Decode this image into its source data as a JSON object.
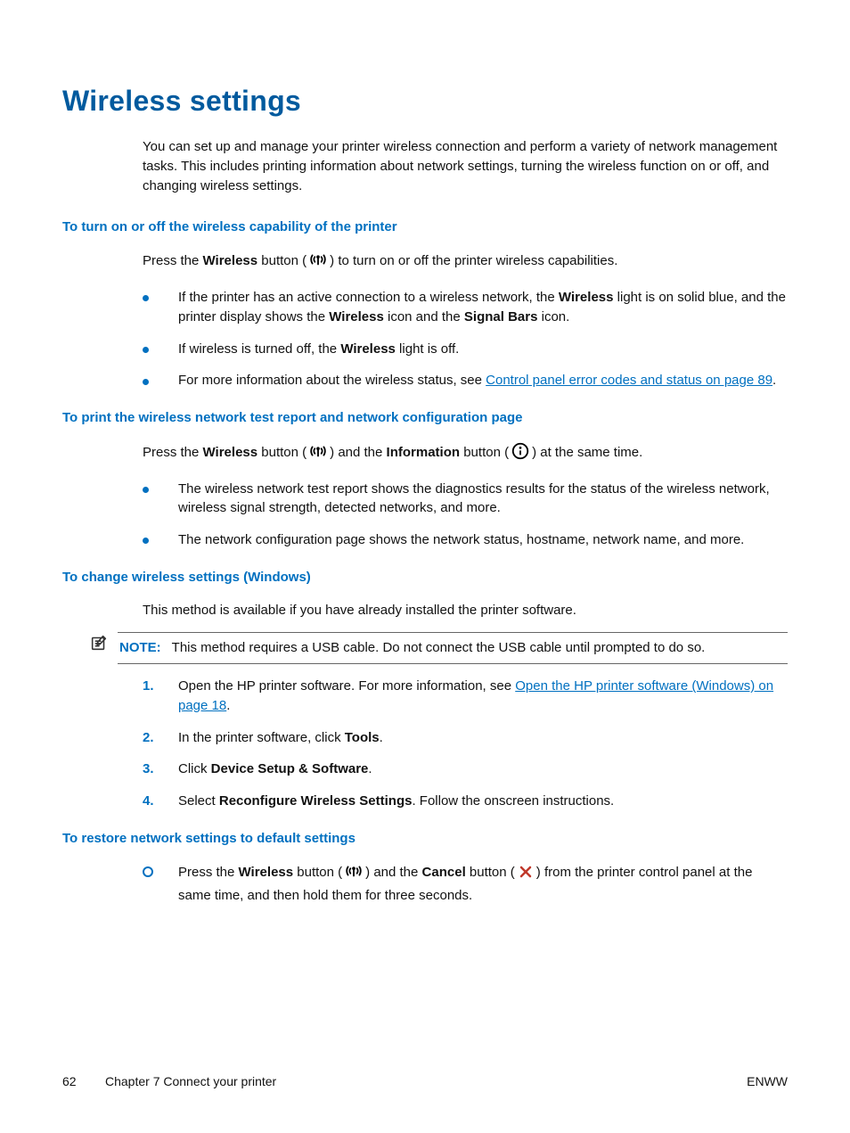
{
  "title": "Wireless settings",
  "intro": "You can set up and manage your printer wireless connection and perform a variety of network management tasks. This includes printing information about network settings, turning the wireless function on or off, and changing wireless settings.",
  "sec1": {
    "heading": "To turn on or off the wireless capability of the printer",
    "lead_pre": "Press the ",
    "lead_b1": "Wireless",
    "lead_mid": " button (",
    "lead_after": ") to turn on or off the printer wireless capabilities.",
    "b": [
      {
        "pre": "If the printer has an active connection to a wireless network, the ",
        "b1": "Wireless",
        "mid1": " light is on solid blue, and the printer display shows the ",
        "b2": "Wireless",
        "mid2": " icon and the ",
        "b3": "Signal Bars",
        "post": " icon."
      },
      {
        "pre": "If wireless is turned off, the ",
        "b1": "Wireless",
        "post": " light is off."
      },
      {
        "pre": "For more information about the wireless status, see ",
        "link": "Control panel error codes and status on page 89",
        "post": "."
      }
    ]
  },
  "sec2": {
    "heading": "To print the wireless network test report and network configuration page",
    "lead_pre": "Press the ",
    "lead_b1": "Wireless",
    "lead_mid1": " button (",
    "lead_mid2": ") and the ",
    "lead_b2": "Information",
    "lead_mid3": " button (",
    "lead_after": ") at the same time.",
    "b": [
      "The wireless network test report shows the diagnostics results for the status of the wireless network, wireless signal strength, detected networks, and more.",
      "The network configuration page shows the network status, hostname, network name, and more."
    ]
  },
  "sec3": {
    "heading": "To change wireless settings (Windows)",
    "lead": "This method is available if you have already installed the printer software.",
    "note_label": "NOTE:",
    "note_text": "This method requires a USB cable. Do not connect the USB cable until prompted to do so.",
    "steps": [
      {
        "pre": "Open the HP printer software. For more information, see ",
        "link": "Open the HP printer software (Windows) on page 18",
        "post": "."
      },
      {
        "pre": "In the printer software, click ",
        "b1": "Tools",
        "post": "."
      },
      {
        "pre": "Click ",
        "b1": "Device Setup & Software",
        "post": "."
      },
      {
        "pre": "Select ",
        "b1": "Reconfigure Wireless Settings",
        "post": ". Follow the onscreen instructions."
      }
    ]
  },
  "sec4": {
    "heading": "To restore network settings to default settings",
    "item": {
      "pre": "Press the ",
      "b1": "Wireless",
      "mid1": " button (",
      "mid2": ") and the ",
      "b2": "Cancel",
      "mid3": " button (",
      "post": ") from the printer control panel at the same time, and then hold them for three seconds."
    }
  },
  "footer": {
    "page": "62",
    "chapter": "Chapter 7   Connect your printer",
    "right": "ENWW"
  }
}
